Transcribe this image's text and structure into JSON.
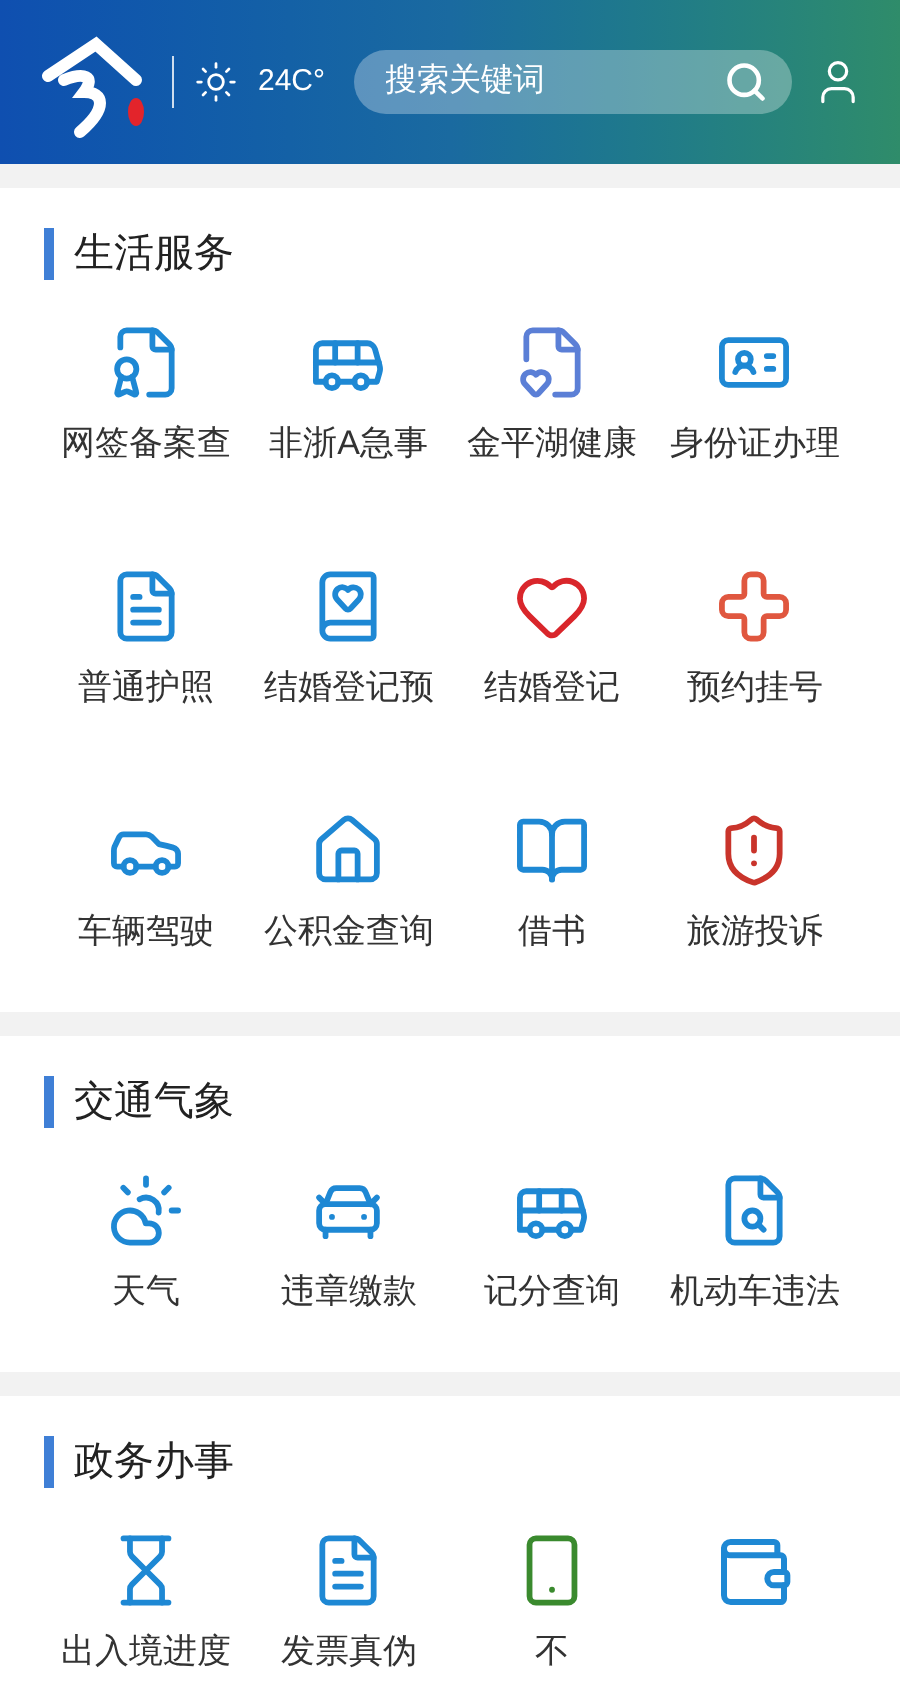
{
  "header": {
    "weather": "24C°",
    "search": {
      "placeholder": "搜索关键词"
    }
  },
  "sections": [
    {
      "title": "生活服务",
      "items": [
        {
          "label": "网签备案查"
        },
        {
          "label": "非浙A急事"
        },
        {
          "label": "金平湖健康"
        },
        {
          "label": "身份证办理"
        },
        {
          "label": "普通护照"
        },
        {
          "label": "结婚登记预"
        },
        {
          "label": "结婚登记"
        },
        {
          "label": "预约挂号"
        },
        {
          "label": "车辆驾驶"
        },
        {
          "label": "公积金查询"
        },
        {
          "label": "借书"
        },
        {
          "label": "旅游投诉"
        }
      ]
    },
    {
      "title": "交通气象",
      "items": [
        {
          "label": "天气"
        },
        {
          "label": "违章缴款"
        },
        {
          "label": "记分查询"
        },
        {
          "label": "机动车违法"
        }
      ]
    },
    {
      "title": "政务办事",
      "items": [
        {
          "label": "出入境进度"
        },
        {
          "label": "发票真伪"
        },
        {
          "label": "不"
        }
      ]
    }
  ]
}
